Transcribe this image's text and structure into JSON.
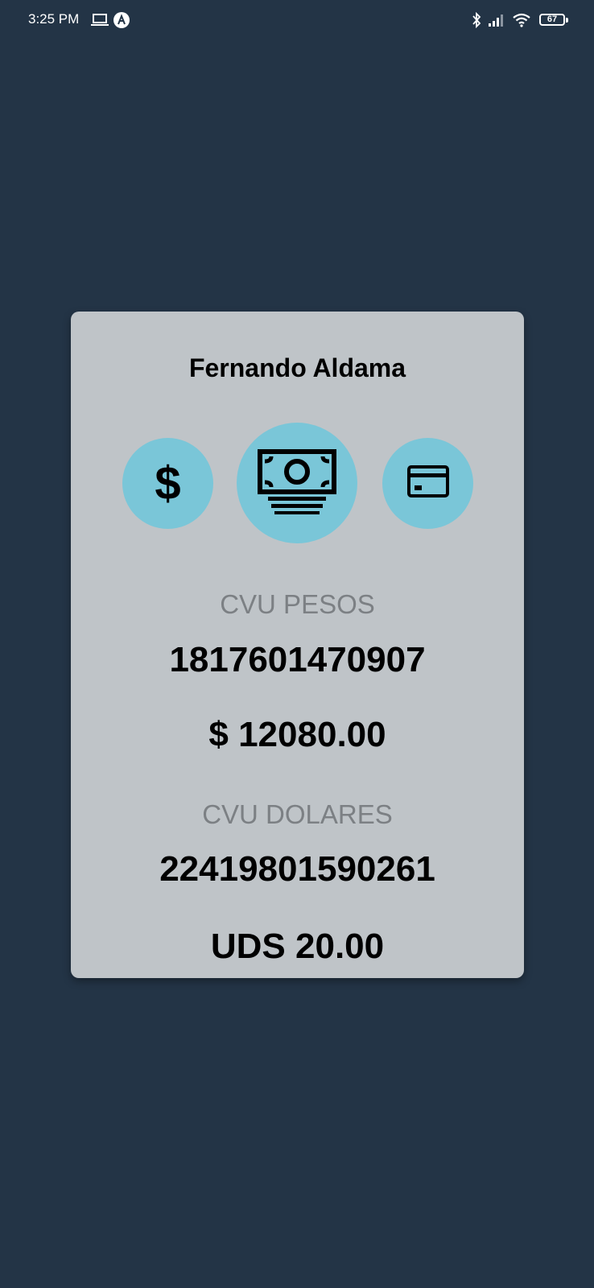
{
  "status_bar": {
    "time": "3:25 PM",
    "battery": "67",
    "icons": [
      "laptop-icon",
      "app-notification-icon",
      "bluetooth-icon",
      "signal-icon",
      "wifi-icon",
      "battery-icon"
    ]
  },
  "card": {
    "user_name": "Fernando Aldama",
    "actions": [
      {
        "icon": "dollar-icon",
        "glyph": "$"
      },
      {
        "icon": "money-bill-icon"
      },
      {
        "icon": "credit-card-icon"
      }
    ],
    "pesos": {
      "label": "CVU PESOS",
      "cvu": "1817601470907",
      "balance": "$ 12080.00"
    },
    "dolares": {
      "label": "CVU DOLARES",
      "cvu": "22419801590261",
      "balance": "UDS 20.00"
    }
  },
  "colors": {
    "background": "#233446",
    "card": "#bfc4c8",
    "accent": "#7ac6d8",
    "label": "#7c8084"
  }
}
